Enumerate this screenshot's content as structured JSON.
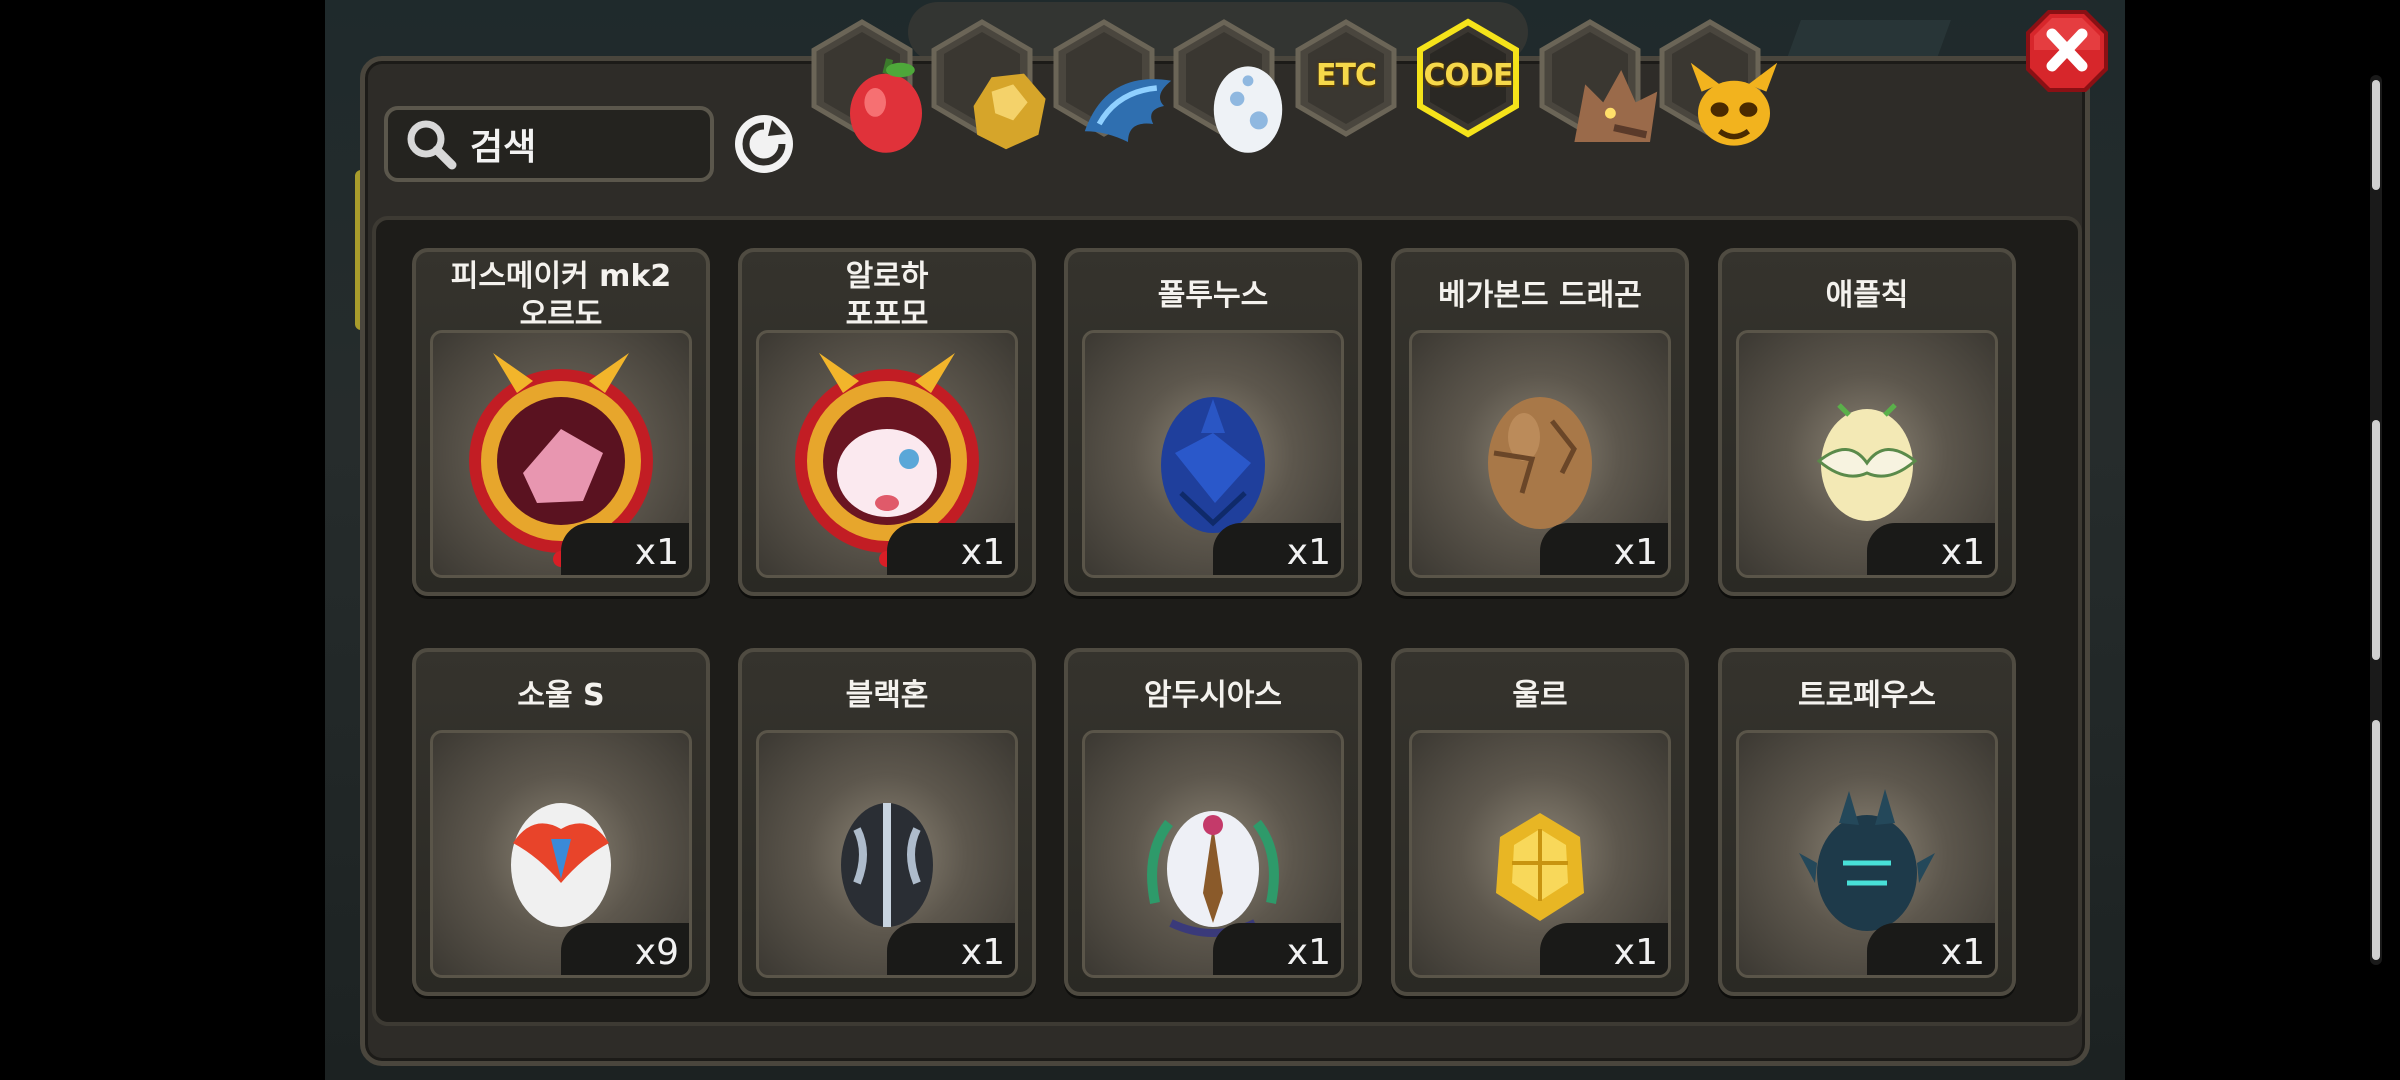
{
  "search": {
    "placeholder": "검색"
  },
  "tabs": [
    {
      "name": "fruit",
      "label": "",
      "icon": "fruit-icon"
    },
    {
      "name": "gold",
      "label": "",
      "icon": "gold-ore-icon"
    },
    {
      "name": "scale",
      "label": "",
      "icon": "dragon-scale-icon"
    },
    {
      "name": "egg",
      "label": "",
      "icon": "egg-icon"
    },
    {
      "name": "etc",
      "label": "ETC",
      "icon": ""
    },
    {
      "name": "code",
      "label": "CODE",
      "icon": "",
      "selected": true
    },
    {
      "name": "wolf",
      "label": "",
      "icon": "wolf-icon"
    },
    {
      "name": "mask",
      "label": "",
      "icon": "demon-mask-icon"
    }
  ],
  "items": [
    {
      "name": "피스메이커 mk2\n오르도",
      "quantity": "x1",
      "icon": "ordo-medal-icon"
    },
    {
      "name": "알로하\n포포모",
      "quantity": "x1",
      "icon": "popomo-medal-icon"
    },
    {
      "name": "폴투누스",
      "quantity": "x1",
      "icon": "blue-egg-icon"
    },
    {
      "name": "베가본드 드래곤",
      "quantity": "x1",
      "icon": "brown-egg-icon"
    },
    {
      "name": "애플칙",
      "quantity": "x1",
      "icon": "winged-egg-icon"
    },
    {
      "name": "소울 S",
      "quantity": "x9",
      "icon": "fire-egg-icon"
    },
    {
      "name": "블랙혼",
      "quantity": "x1",
      "icon": "black-horn-egg-icon"
    },
    {
      "name": "암두시아스",
      "quantity": "x1",
      "icon": "laurel-egg-icon"
    },
    {
      "name": "울르",
      "quantity": "x1",
      "icon": "gold-egg-icon"
    },
    {
      "name": "트로페우스",
      "quantity": "x1",
      "icon": "spiked-egg-icon"
    }
  ],
  "colors": {
    "accent": "#f6d84a",
    "close": "#d7262b",
    "panel": "#2e2c28"
  }
}
